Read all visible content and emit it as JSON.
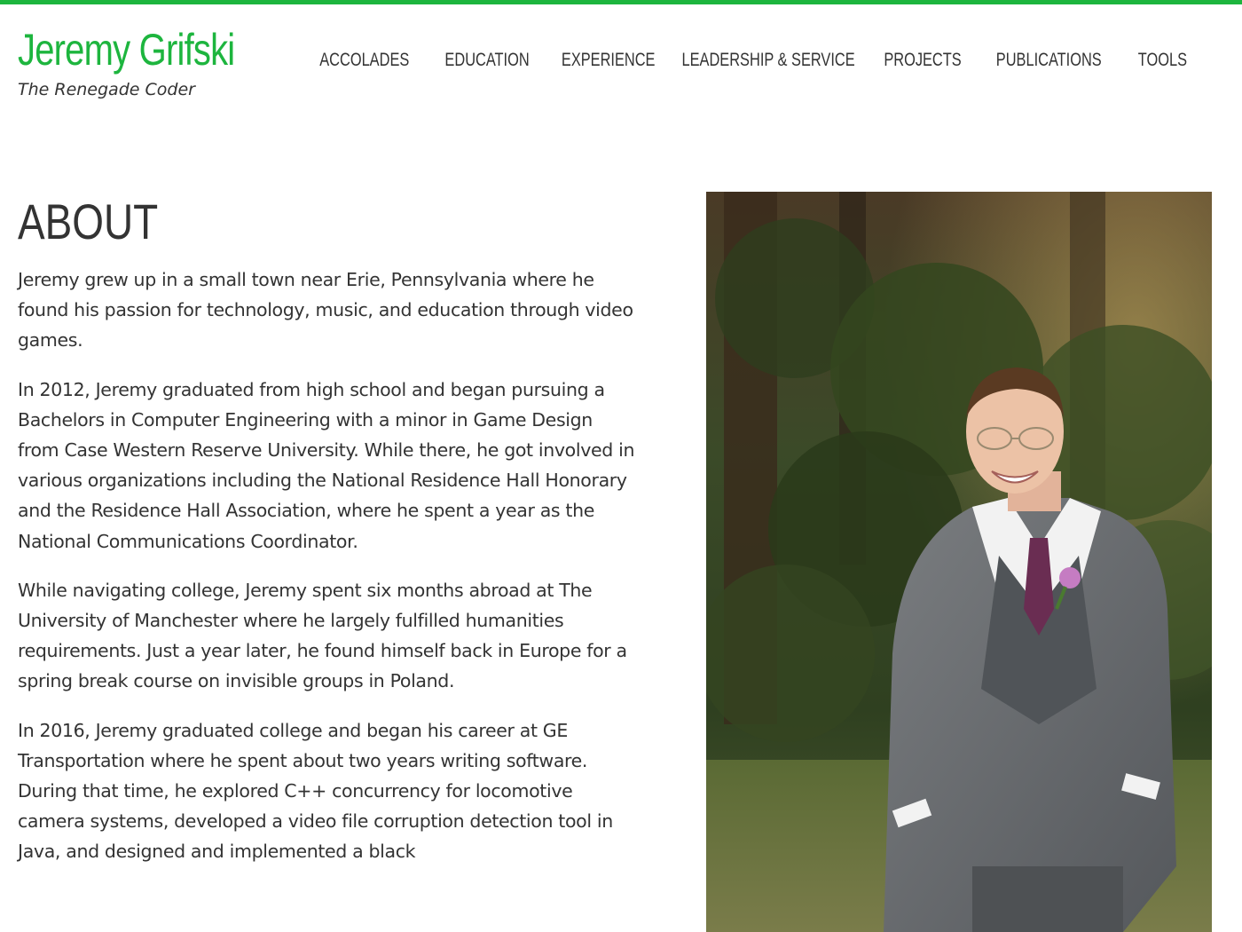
{
  "site": {
    "title": "Jeremy Grifski",
    "tagline": "The Renegade Coder"
  },
  "nav": {
    "items": [
      {
        "label": "ACCOLADES"
      },
      {
        "label": "EDUCATION"
      },
      {
        "label": "EXPERIENCE"
      },
      {
        "label": "LEADERSHIP & SERVICE"
      },
      {
        "label": "PROJECTS"
      },
      {
        "label": "PUBLICATIONS"
      },
      {
        "label": "TOOLS"
      }
    ]
  },
  "about": {
    "heading": "ABOUT",
    "paragraphs": [
      "Jeremy grew up in a small town near Erie, Pennsylvania where he found his passion for technology, music, and education through video games.",
      "In 2012, Jeremy graduated from high school and began pursuing a Bachelors in Computer Engineering with a minor in Game Design from Case Western Reserve University. While there, he got involved in various organizations including the National Residence Hall Honorary and the Residence Hall Association, where he spent a year as the National Communications Coordinator.",
      "While navigating college, Jeremy spent six months abroad at The University of Manchester where he largely fulfilled humanities requirements. Just a year later, he found himself back in Europe for a spring break course on invisible groups in Poland.",
      "In 2016, Jeremy graduated college and began his career at GE Transportation where he spent about two years writing software. During that time, he explored C++ concurrency for locomotive camera systems, developed a video file corruption detection tool in Java, and designed and implemented a black"
    ]
  },
  "colors": {
    "accent": "#1db53e",
    "text": "#333333",
    "background": "#ffffff"
  }
}
